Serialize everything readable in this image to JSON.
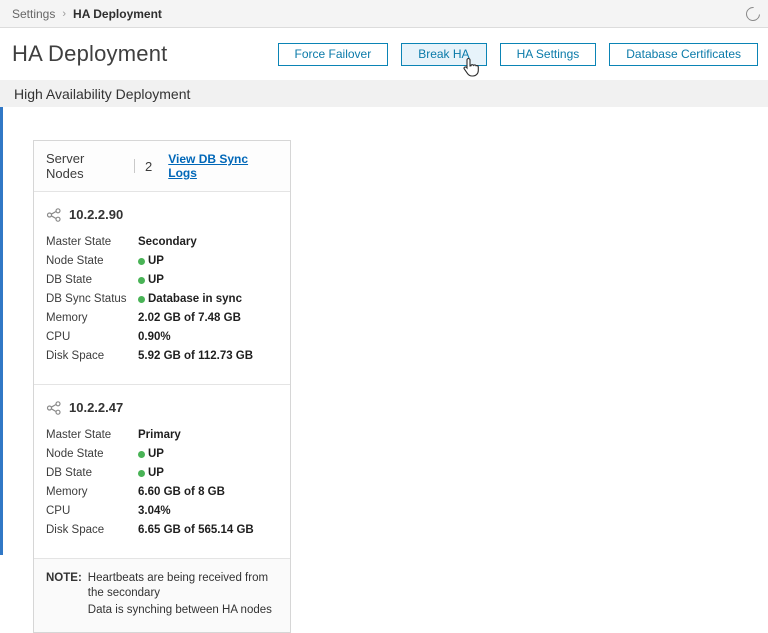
{
  "breadcrumb": {
    "root": "Settings",
    "separator": "›",
    "current": "HA Deployment"
  },
  "header": {
    "title": "HA Deployment",
    "buttons": [
      {
        "label": "Force Failover"
      },
      {
        "label": "Break HA"
      },
      {
        "label": "HA Settings"
      },
      {
        "label": "Database Certificates"
      }
    ]
  },
  "section": {
    "title": "High Availability Deployment"
  },
  "card": {
    "server_nodes_label": "Server Nodes",
    "server_nodes_count": "2",
    "sync_logs_link": "View DB Sync Logs",
    "nodes": [
      {
        "ip": "10.2.2.90",
        "rows": [
          {
            "label": "Master State",
            "value": "Secondary"
          },
          {
            "label": "Node State",
            "value": "UP"
          },
          {
            "label": "DB State",
            "value": "UP"
          },
          {
            "label": "DB Sync Status",
            "value": "Database in sync"
          },
          {
            "label": "Memory",
            "value": "2.02 GB of 7.48 GB"
          },
          {
            "label": "CPU",
            "value": "0.90%"
          },
          {
            "label": "Disk Space",
            "value": "5.92 GB of 112.73 GB"
          }
        ]
      },
      {
        "ip": "10.2.2.47",
        "rows": [
          {
            "label": "Master State",
            "value": "Primary"
          },
          {
            "label": "Node State",
            "value": "UP"
          },
          {
            "label": "DB State",
            "value": "UP"
          },
          {
            "label": "Memory",
            "value": "6.60 GB of 8 GB"
          },
          {
            "label": "CPU",
            "value": "3.04%"
          },
          {
            "label": "Disk Space",
            "value": "6.65 GB of 565.14 GB"
          }
        ]
      }
    ],
    "note": {
      "label": "NOTE:",
      "lines": [
        "Heartbeats are being received from the secondary",
        "Data is synching between HA nodes"
      ]
    }
  },
  "colors": {
    "accent_blue": "#0b84b5",
    "link_blue": "#0067b8",
    "status_green": "#49b356",
    "left_accent": "#3178c6"
  }
}
